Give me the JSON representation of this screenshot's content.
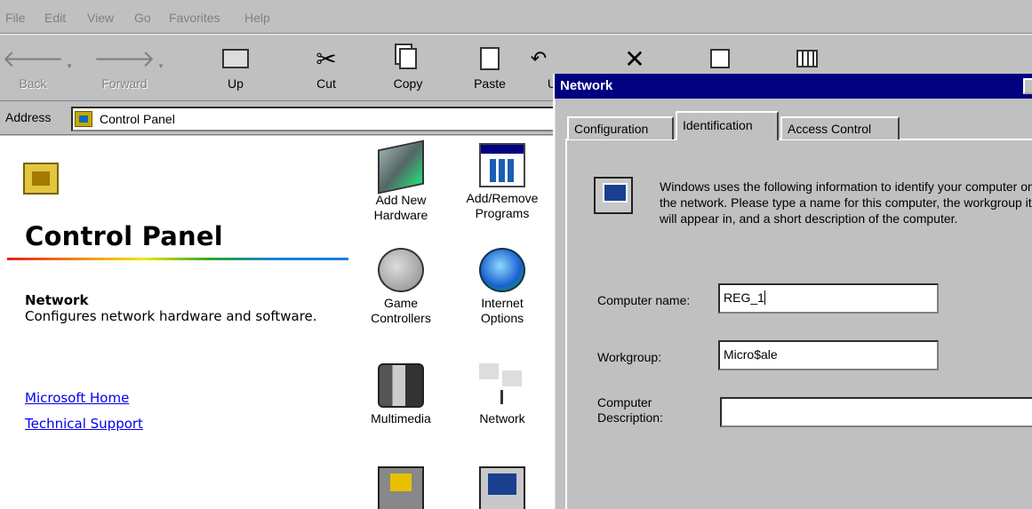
{
  "menu": [
    "File",
    "Edit",
    "View",
    "Go",
    "Favorites",
    "Help"
  ],
  "toolbar": {
    "back": "Back",
    "forward": "Forward",
    "up": "Up",
    "cut": "Cut",
    "copy": "Copy",
    "paste": "Paste",
    "undo_partial": "U"
  },
  "address": {
    "label": "Address",
    "value": "Control Panel"
  },
  "sidepane": {
    "title": "Control Panel",
    "selected_name": "Network",
    "selected_desc": "Configures network hardware and software.",
    "links": [
      "Microsoft Home",
      "Technical Support"
    ]
  },
  "items": [
    {
      "name": "add-new-hardware",
      "icon": "hardware-icon",
      "label": [
        "Add New",
        "Hardware"
      ]
    },
    {
      "name": "add-remove-programs",
      "icon": "programs-icon",
      "label": [
        "Add/Remove",
        "Programs"
      ]
    },
    {
      "name": "game-controllers",
      "icon": "joystick-icon",
      "label": [
        "Game",
        "Controllers"
      ]
    },
    {
      "name": "internet-options",
      "icon": "globe-icon",
      "label": [
        "Internet",
        "Options"
      ]
    },
    {
      "name": "multimedia",
      "icon": "multimedia-icon",
      "label": [
        "Multimedia"
      ]
    },
    {
      "name": "network",
      "icon": "network-icon",
      "label": [
        "Network"
      ]
    },
    {
      "name": "sounds",
      "icon": "speaker-icon",
      "label": []
    },
    {
      "name": "system",
      "icon": "computer-icon",
      "label": []
    }
  ],
  "dialog": {
    "title": "Network",
    "tabs": [
      "Configuration",
      "Identification",
      "Access Control"
    ],
    "active_tab": "Identification",
    "intro": "Windows uses the following information to identify your computer on the network.  Please type a name for this computer, the workgroup it will appear in, and a short description of the computer.",
    "computer_name_label": "Computer name:",
    "computer_name_value": "REG_1",
    "workgroup_label": "Workgroup:",
    "workgroup_value": "Micro$ale",
    "description_label_1": "Computer",
    "description_label_2": "Description:",
    "description_value": ""
  },
  "colors": {
    "window_bg": "#c0c0c0",
    "title_bar": "#000080",
    "link": "#0000ee"
  }
}
